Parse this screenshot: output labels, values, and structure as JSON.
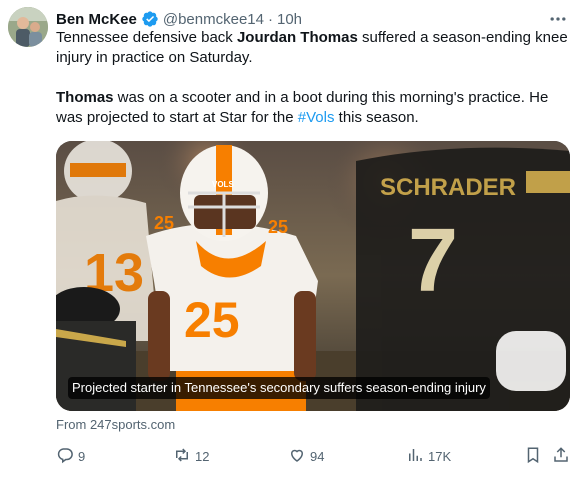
{
  "author": {
    "name": "Ben McKee",
    "handle": "@benmckee14",
    "separator": "·",
    "time": "10h",
    "verified_color": "#1d9bf0"
  },
  "tweet": {
    "p1_a": "Tennessee defensive back ",
    "p1_bold": "Jourdan Thomas",
    "p1_b": " suffered a season-ending knee injury in practice on Saturday.",
    "p2_bold": "Thomas",
    "p2_a": " was on a scooter and in a boot during this morning's practice. He was projected to start at Star for the ",
    "p2_hashtag": "#Vols",
    "p2_b": " this season."
  },
  "card": {
    "caption": "Projected starter in Tennessee's secondary suffers season-ending injury",
    "jersey_number": "25",
    "helmet_text": "VOLS",
    "opponent_name": "SCHRADER",
    "opponent_number": "7",
    "background_number": "13"
  },
  "source": "From 247sports.com",
  "actions": {
    "replies": "9",
    "reposts": "12",
    "likes": "94",
    "views": "17K"
  },
  "colors": {
    "accent": "#1d9bf0",
    "secondary_text": "#536471",
    "tennessee_orange": "#f77f00"
  },
  "icons": [
    "more-icon",
    "verified-icon",
    "reply-icon",
    "repost-icon",
    "like-icon",
    "views-icon",
    "bookmark-icon",
    "share-icon"
  ]
}
